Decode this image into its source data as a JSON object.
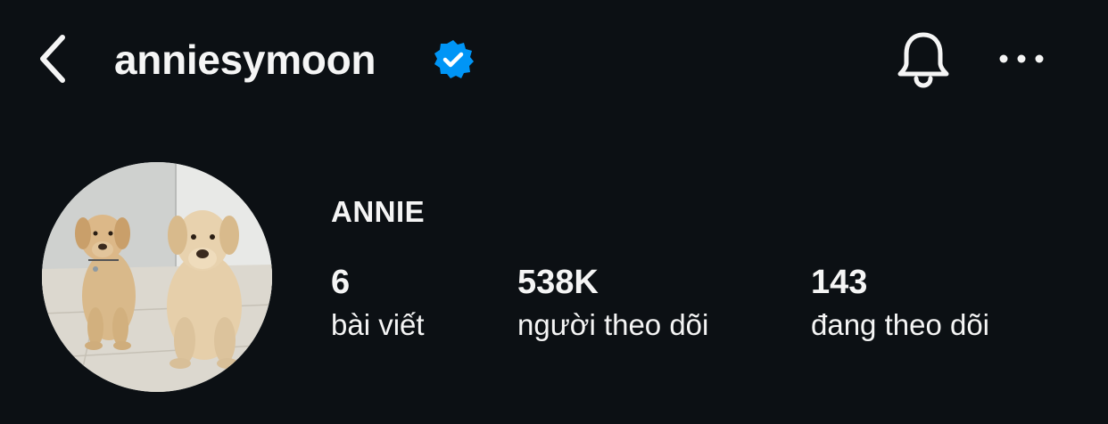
{
  "header": {
    "back_icon": "chevron-left-icon",
    "username": "anniesymoon",
    "verified_icon": "verified-badge-icon",
    "verified_color": "#0095f6",
    "notification_icon": "bell-icon",
    "more_icon": "more-horizontal-icon"
  },
  "profile": {
    "avatar_icon": "profile-photo-two-labradors",
    "display_name": "ANNIE",
    "stats": [
      {
        "value": "6",
        "label": "bài viết"
      },
      {
        "value": "538K",
        "label": "người theo dõi"
      },
      {
        "value": "143",
        "label": "đang theo dõi"
      }
    ]
  },
  "colors": {
    "background": "#0c1014",
    "text": "#f5f5f5",
    "accent": "#0095f6"
  }
}
